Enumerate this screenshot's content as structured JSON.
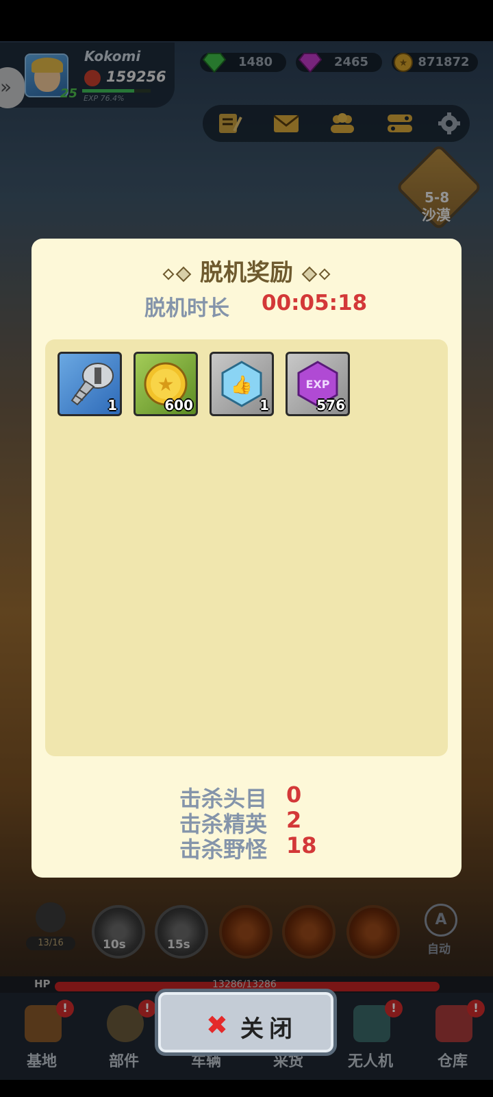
{
  "player": {
    "name": "Kokomi",
    "level": "25",
    "power": "159256",
    "exp_text": "EXP 76.4%",
    "exp_fraction": 0.764
  },
  "currencies": [
    {
      "name": "green-gem",
      "value": "1480",
      "color": "#3fbf4a"
    },
    {
      "name": "purple-gem",
      "value": "2465",
      "color": "#c03ac8"
    },
    {
      "name": "gold-coin",
      "value": "871872",
      "color": "#d6a22a"
    }
  ],
  "toolbar": {
    "icons": [
      "notes-icon",
      "mail-icon",
      "friends-icon",
      "toggle-icon",
      "gear-icon"
    ]
  },
  "stage": {
    "number": "5-8",
    "name": "沙漠"
  },
  "modal": {
    "title": "脱机奖励",
    "duration_label": "脱机时长",
    "duration_value": "00:05:18",
    "rewards": [
      {
        "icon": "screw-icon",
        "count": "1"
      },
      {
        "icon": "gold-coin-icon",
        "count": "600"
      },
      {
        "icon": "thumbs-up-gem-icon",
        "count": "1"
      },
      {
        "icon": "exp-gem-icon",
        "count": "576"
      }
    ],
    "stats": [
      {
        "label": "击杀头目",
        "value": "0"
      },
      {
        "label": "击杀精英",
        "value": "2"
      },
      {
        "label": "击杀野怪",
        "value": "18"
      }
    ]
  },
  "close_button": {
    "label": "关闭"
  },
  "skills": [
    {
      "cooldown": "10s"
    },
    {
      "cooldown": "15s"
    },
    {
      "cooldown": ""
    },
    {
      "cooldown": ""
    },
    {
      "cooldown": ""
    }
  ],
  "bullets": "13/16",
  "auto_label": "自动",
  "hp": {
    "label": "HP",
    "text": "13286/13286",
    "fraction": 1.0
  },
  "bottom_nav": [
    {
      "label": "基地",
      "badge": "!"
    },
    {
      "label": "部件",
      "badge": "!"
    },
    {
      "label": "车辆",
      "badge": ""
    },
    {
      "label": "采货",
      "badge": ""
    },
    {
      "label": "无人机",
      "badge": "!"
    },
    {
      "label": "仓库",
      "badge": "!"
    }
  ]
}
